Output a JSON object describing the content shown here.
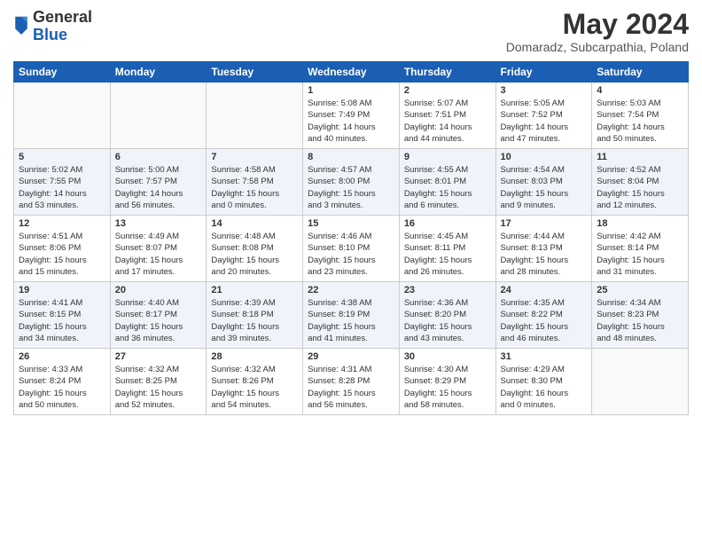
{
  "header": {
    "logo_general": "General",
    "logo_blue": "Blue",
    "month_title": "May 2024",
    "location": "Domaradz, Subcarpathia, Poland"
  },
  "weekdays": [
    "Sunday",
    "Monday",
    "Tuesday",
    "Wednesday",
    "Thursday",
    "Friday",
    "Saturday"
  ],
  "weeks": [
    [
      {
        "day": "",
        "info": ""
      },
      {
        "day": "",
        "info": ""
      },
      {
        "day": "",
        "info": ""
      },
      {
        "day": "1",
        "info": "Sunrise: 5:08 AM\nSunset: 7:49 PM\nDaylight: 14 hours\nand 40 minutes."
      },
      {
        "day": "2",
        "info": "Sunrise: 5:07 AM\nSunset: 7:51 PM\nDaylight: 14 hours\nand 44 minutes."
      },
      {
        "day": "3",
        "info": "Sunrise: 5:05 AM\nSunset: 7:52 PM\nDaylight: 14 hours\nand 47 minutes."
      },
      {
        "day": "4",
        "info": "Sunrise: 5:03 AM\nSunset: 7:54 PM\nDaylight: 14 hours\nand 50 minutes."
      }
    ],
    [
      {
        "day": "5",
        "info": "Sunrise: 5:02 AM\nSunset: 7:55 PM\nDaylight: 14 hours\nand 53 minutes."
      },
      {
        "day": "6",
        "info": "Sunrise: 5:00 AM\nSunset: 7:57 PM\nDaylight: 14 hours\nand 56 minutes."
      },
      {
        "day": "7",
        "info": "Sunrise: 4:58 AM\nSunset: 7:58 PM\nDaylight: 15 hours\nand 0 minutes."
      },
      {
        "day": "8",
        "info": "Sunrise: 4:57 AM\nSunset: 8:00 PM\nDaylight: 15 hours\nand 3 minutes."
      },
      {
        "day": "9",
        "info": "Sunrise: 4:55 AM\nSunset: 8:01 PM\nDaylight: 15 hours\nand 6 minutes."
      },
      {
        "day": "10",
        "info": "Sunrise: 4:54 AM\nSunset: 8:03 PM\nDaylight: 15 hours\nand 9 minutes."
      },
      {
        "day": "11",
        "info": "Sunrise: 4:52 AM\nSunset: 8:04 PM\nDaylight: 15 hours\nand 12 minutes."
      }
    ],
    [
      {
        "day": "12",
        "info": "Sunrise: 4:51 AM\nSunset: 8:06 PM\nDaylight: 15 hours\nand 15 minutes."
      },
      {
        "day": "13",
        "info": "Sunrise: 4:49 AM\nSunset: 8:07 PM\nDaylight: 15 hours\nand 17 minutes."
      },
      {
        "day": "14",
        "info": "Sunrise: 4:48 AM\nSunset: 8:08 PM\nDaylight: 15 hours\nand 20 minutes."
      },
      {
        "day": "15",
        "info": "Sunrise: 4:46 AM\nSunset: 8:10 PM\nDaylight: 15 hours\nand 23 minutes."
      },
      {
        "day": "16",
        "info": "Sunrise: 4:45 AM\nSunset: 8:11 PM\nDaylight: 15 hours\nand 26 minutes."
      },
      {
        "day": "17",
        "info": "Sunrise: 4:44 AM\nSunset: 8:13 PM\nDaylight: 15 hours\nand 28 minutes."
      },
      {
        "day": "18",
        "info": "Sunrise: 4:42 AM\nSunset: 8:14 PM\nDaylight: 15 hours\nand 31 minutes."
      }
    ],
    [
      {
        "day": "19",
        "info": "Sunrise: 4:41 AM\nSunset: 8:15 PM\nDaylight: 15 hours\nand 34 minutes."
      },
      {
        "day": "20",
        "info": "Sunrise: 4:40 AM\nSunset: 8:17 PM\nDaylight: 15 hours\nand 36 minutes."
      },
      {
        "day": "21",
        "info": "Sunrise: 4:39 AM\nSunset: 8:18 PM\nDaylight: 15 hours\nand 39 minutes."
      },
      {
        "day": "22",
        "info": "Sunrise: 4:38 AM\nSunset: 8:19 PM\nDaylight: 15 hours\nand 41 minutes."
      },
      {
        "day": "23",
        "info": "Sunrise: 4:36 AM\nSunset: 8:20 PM\nDaylight: 15 hours\nand 43 minutes."
      },
      {
        "day": "24",
        "info": "Sunrise: 4:35 AM\nSunset: 8:22 PM\nDaylight: 15 hours\nand 46 minutes."
      },
      {
        "day": "25",
        "info": "Sunrise: 4:34 AM\nSunset: 8:23 PM\nDaylight: 15 hours\nand 48 minutes."
      }
    ],
    [
      {
        "day": "26",
        "info": "Sunrise: 4:33 AM\nSunset: 8:24 PM\nDaylight: 15 hours\nand 50 minutes."
      },
      {
        "day": "27",
        "info": "Sunrise: 4:32 AM\nSunset: 8:25 PM\nDaylight: 15 hours\nand 52 minutes."
      },
      {
        "day": "28",
        "info": "Sunrise: 4:32 AM\nSunset: 8:26 PM\nDaylight: 15 hours\nand 54 minutes."
      },
      {
        "day": "29",
        "info": "Sunrise: 4:31 AM\nSunset: 8:28 PM\nDaylight: 15 hours\nand 56 minutes."
      },
      {
        "day": "30",
        "info": "Sunrise: 4:30 AM\nSunset: 8:29 PM\nDaylight: 15 hours\nand 58 minutes."
      },
      {
        "day": "31",
        "info": "Sunrise: 4:29 AM\nSunset: 8:30 PM\nDaylight: 16 hours\nand 0 minutes."
      },
      {
        "day": "",
        "info": ""
      }
    ]
  ]
}
